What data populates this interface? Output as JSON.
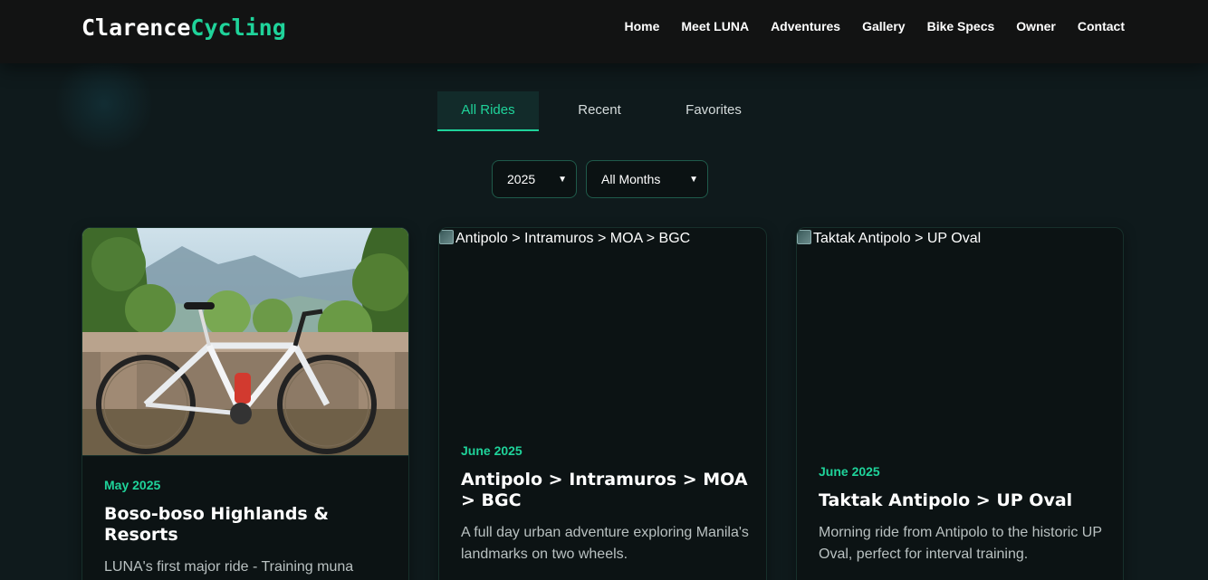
{
  "brand": {
    "part1": "Clarence",
    "part2": "Cycling"
  },
  "nav": [
    "Home",
    "Meet LUNA",
    "Adventures",
    "Gallery",
    "Bike Specs",
    "Owner",
    "Contact"
  ],
  "tabs": [
    {
      "label": "All Rides",
      "active": true
    },
    {
      "label": "Recent",
      "active": false
    },
    {
      "label": "Favorites",
      "active": false
    }
  ],
  "filters": {
    "year": "2025",
    "month": "All Months"
  },
  "cards": [
    {
      "image_alt": "",
      "date": "May 2025",
      "title": "Boso-boso Highlands & Resorts",
      "description": "LUNA's first major ride - Training muna"
    },
    {
      "image_alt": "Antipolo > Intramuros > MOA > BGC",
      "date": "June 2025",
      "title": "Antipolo > Intramuros > MOA > BGC",
      "description": "A full day urban adventure exploring Manila's landmarks on two wheels."
    },
    {
      "image_alt": "Taktak Antipolo > UP Oval",
      "date": "June 2025",
      "title": "Taktak Antipolo > UP Oval",
      "description": "Morning ride from Antipolo to the historic UP Oval, perfect for interval training."
    }
  ],
  "colors": {
    "accent": "#1fd39a",
    "background": "#0f1a1c",
    "navbar": "#121313",
    "card": "#0c1314"
  }
}
